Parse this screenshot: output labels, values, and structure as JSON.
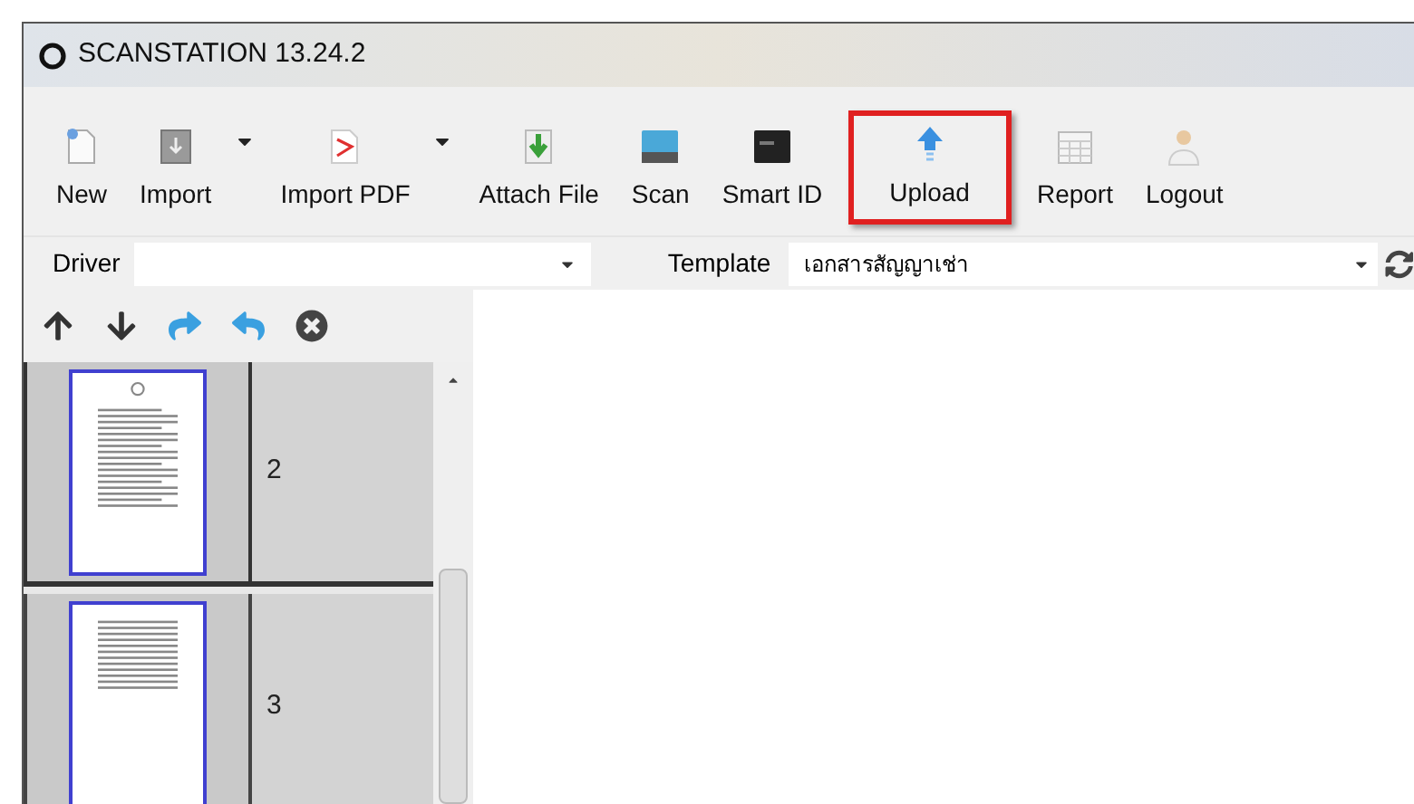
{
  "window": {
    "title": "SCANSTATION 13.24.2"
  },
  "toolbar": [
    {
      "label": "New",
      "kind": "button",
      "highlighted": false
    },
    {
      "label": "Import",
      "kind": "dropdown",
      "highlighted": false
    },
    {
      "label": "Import PDF",
      "kind": "dropdown",
      "highlighted": false
    },
    {
      "label": "Attach File",
      "kind": "button",
      "highlighted": false
    },
    {
      "label": "Scan",
      "kind": "button",
      "highlighted": false
    },
    {
      "label": "Smart ID",
      "kind": "button",
      "highlighted": false
    },
    {
      "label": "Upload",
      "kind": "button",
      "highlighted": true
    },
    {
      "label": "Report",
      "kind": "button",
      "highlighted": false
    },
    {
      "label": "Logout",
      "kind": "button",
      "highlighted": false
    }
  ],
  "driver": {
    "label": "Driver"
  },
  "template": {
    "label": "Template",
    "value": "เอกสารสัญญาเช่า"
  },
  "pages": [
    {
      "number": "2",
      "selected": true
    },
    {
      "number": "3",
      "selected": false
    }
  ]
}
